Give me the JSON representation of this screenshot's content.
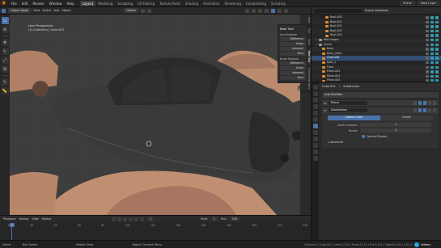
{
  "menu": {
    "items": [
      "File",
      "Edit",
      "Render",
      "Window",
      "Help"
    ],
    "workspaces": [
      "Layout",
      "Modeling",
      "Sculpting",
      "UV Editing",
      "Texture Paint",
      "Shading",
      "Animation",
      "Rendering",
      "Compositing",
      "Scripting"
    ],
    "active_workspace": "Layout",
    "scene": "Scene",
    "view_layer": "View Layer"
  },
  "viewport_header": {
    "mode": "Object Mode",
    "items": [
      "View",
      "Select",
      "Add",
      "Object"
    ],
    "orientation": "Global"
  },
  "viewport": {
    "view_name": "User Perspective",
    "collection_info": "(1) Collection | Cube.001"
  },
  "sidebar_tabs": [
    "Item",
    "Tool",
    "View",
    "Bool Tool",
    "Screencast Keys"
  ],
  "bool_tool": {
    "title": "Bool Tool",
    "auto_label": "Auto Boolean",
    "auto_ops": [
      "Difference",
      "Union",
      "Intersect",
      "Slice"
    ],
    "brush_label": "Brush Boolean",
    "brush_ops": [
      "Difference",
      "Union",
      "Intersect",
      "Slice"
    ]
  },
  "outliner": {
    "title": "Scene Collection",
    "rows": [
      {
        "name": "Bool.000",
        "indent": 3,
        "kind": "mesh"
      },
      {
        "name": "Bool.001",
        "indent": 3,
        "kind": "mesh"
      },
      {
        "name": "Bool.002",
        "indent": 3,
        "kind": "mesh"
      },
      {
        "name": "Bool.003",
        "indent": 3,
        "kind": "mesh"
      },
      {
        "name": "Bool.004",
        "indent": 3,
        "kind": "mesh"
      },
      {
        "name": "Ref Images",
        "indent": 1,
        "kind": "col"
      },
      {
        "name": "Scene",
        "indent": 1,
        "kind": "col"
      },
      {
        "name": "Body",
        "indent": 2,
        "kind": "mesh"
      },
      {
        "name": "Body_Gaps",
        "indent": 2,
        "kind": "mesh"
      },
      {
        "name": "Cube.001",
        "indent": 2,
        "kind": "mesh",
        "selected": true
      },
      {
        "name": "Door_L",
        "indent": 2,
        "kind": "mesh"
      },
      {
        "name": "Floor",
        "indent": 2,
        "kind": "mesh"
      },
      {
        "name": "Plane.001",
        "indent": 2,
        "kind": "mesh"
      },
      {
        "name": "Plane.002",
        "indent": 2,
        "kind": "mesh"
      },
      {
        "name": "Plane.003",
        "indent": 2,
        "kind": "mesh"
      }
    ]
  },
  "properties": {
    "context": [
      "Cube.001",
      "Subdivision"
    ],
    "add_modifier": "Add Modifier",
    "modifiers": [
      {
        "name": "Mirror"
      },
      {
        "name": "Subdivision"
      }
    ],
    "subdiv_types": [
      "Catmull-Clark",
      "Simple"
    ],
    "levels_label": "Levels Viewport",
    "levels_value": "1",
    "render_label": "Render",
    "render_value": "2",
    "optimal_label": "Optimal Display",
    "advanced_label": "Advanced"
  },
  "timeline": {
    "menus": [
      "Playback",
      "Keying",
      "View",
      "Marker"
    ],
    "current_frame": "1",
    "start_label": "Start",
    "start": "1",
    "end_label": "End",
    "end": "250",
    "ticks": [
      "0",
      "20",
      "40",
      "60",
      "80",
      "100",
      "120",
      "140",
      "160",
      "180",
      "200",
      "220",
      "240"
    ]
  },
  "status": {
    "select": "Select",
    "box_select": "Box Select",
    "rotate": "Rotate View",
    "context_menu": "Object Context Menu",
    "stats": "Collection | Cube.001 | Verts:1,716 | Faces:1,712 | Tris:3,424 | Objects:1/40 | 2.91.0",
    "brand": "Udemy"
  },
  "colors": {
    "accent": "#4b73a9",
    "car_dark": "#3a3a3b",
    "car_clay": "#b98a6e",
    "viewport_bg": "#3d3d3d"
  }
}
